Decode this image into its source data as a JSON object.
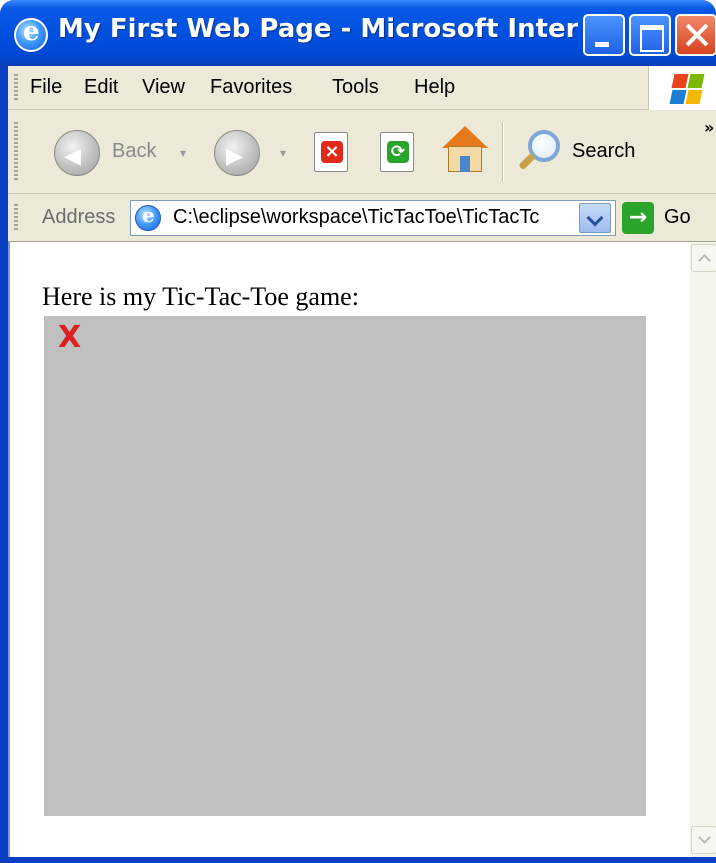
{
  "window": {
    "title": "My First Web Page - Microsoft Internet ...",
    "icon": "ie-logo-icon"
  },
  "menubar": {
    "items": [
      {
        "label": "File",
        "mnemonic": "F"
      },
      {
        "label": "Edit",
        "mnemonic": "E"
      },
      {
        "label": "View",
        "mnemonic": "V"
      },
      {
        "label": "Favorites",
        "mnemonic": "a"
      },
      {
        "label": "Tools",
        "mnemonic": "T"
      },
      {
        "label": "Help",
        "mnemonic": "H"
      }
    ]
  },
  "toolbar": {
    "back_label": "Back",
    "search_label": "Search",
    "overflow": "»"
  },
  "addressbar": {
    "label": "Address",
    "value": "C:\\eclipse\\workspace\\TicTacToe\\TicTacTc",
    "go_label": "Go"
  },
  "content": {
    "text": "Here is my Tic-Tac-Toe game:",
    "board": {
      "background": "#c0c0c0",
      "marks": [
        {
          "symbol": "X",
          "color": "#dd1f1f"
        }
      ]
    }
  },
  "colors": {
    "titlebar": "#0050e0",
    "chrome": "#ece9d8",
    "board": "#c0c0c0",
    "x_mark": "#dd1f1f"
  }
}
